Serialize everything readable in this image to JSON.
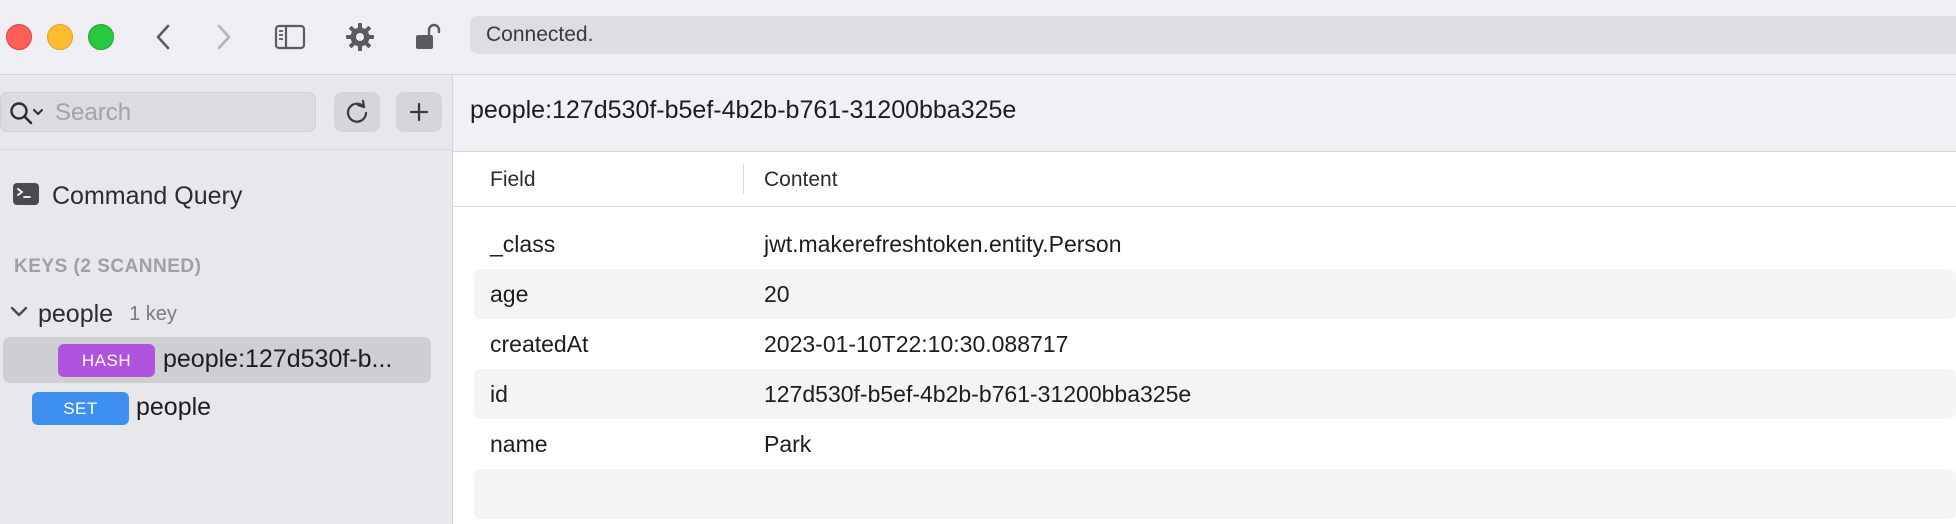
{
  "toolbar": {
    "status": "Connected."
  },
  "sidebar": {
    "search_placeholder": "Search",
    "command_query_label": "Command Query",
    "keys_section_header": "KEYS (2 SCANNED)",
    "group": {
      "name": "people",
      "count": "1 key"
    },
    "keys": [
      {
        "type": "HASH",
        "type_color": "#af52de",
        "name": "people:127d530f-b...",
        "selected": true
      },
      {
        "type": "SET",
        "type_color": "#3d8ff0",
        "name": "people",
        "selected": false
      }
    ]
  },
  "main": {
    "key_title": "people:127d530f-b5ef-4b2b-b761-31200bba325e",
    "columns": [
      "Field",
      "Content"
    ],
    "rows": [
      {
        "field": "_class",
        "content": "jwt.makerefreshtoken.entity.Person"
      },
      {
        "field": "age",
        "content": "20"
      },
      {
        "field": "createdAt",
        "content": "2023-01-10T22:10:30.088717"
      },
      {
        "field": "id",
        "content": "127d530f-b5ef-4b2b-b761-31200bba325e"
      },
      {
        "field": "name",
        "content": "Park"
      },
      {
        "field": "",
        "content": ""
      }
    ]
  },
  "colors": {
    "hash_badge": "#af52de",
    "set_badge": "#3d8ff0",
    "close": "#fe5f57",
    "minimize": "#febc2e",
    "maximize": "#28c840"
  }
}
